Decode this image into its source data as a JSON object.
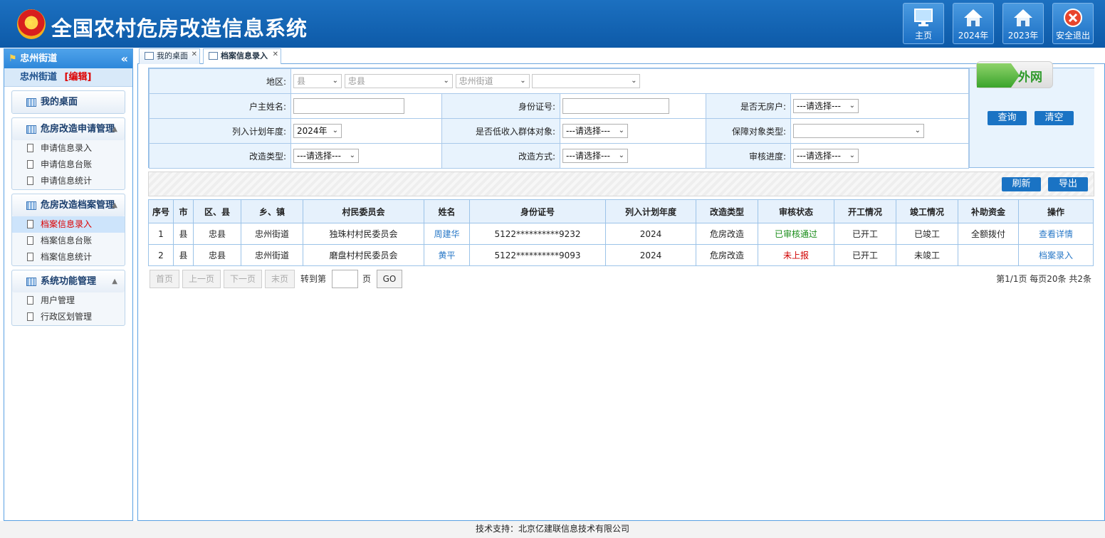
{
  "header": {
    "title": "全国农村危房改造信息系统",
    "buttons": [
      {
        "label": "主页",
        "icon": "monitor-icon"
      },
      {
        "label": "2024年",
        "icon": "house-icon"
      },
      {
        "label": "2023年",
        "icon": "house-icon"
      },
      {
        "label": "安全退出",
        "icon": "close-icon"
      }
    ]
  },
  "sidebar": {
    "region": "忠州街道",
    "user": "忠州街道",
    "edit_label": "[编辑]",
    "collapse_glyph": "«",
    "groups": [
      {
        "title": "我的桌面",
        "items": []
      },
      {
        "title": "危房改造申请管理",
        "items": [
          "申请信息录入",
          "申请信息台账",
          "申请信息统计"
        ]
      },
      {
        "title": "危房改造档案管理",
        "items": [
          "档案信息录入",
          "档案信息台账",
          "档案信息统计"
        ]
      },
      {
        "title": "系统功能管理",
        "items": [
          "用户管理",
          "行政区划管理"
        ]
      }
    ]
  },
  "tabs": [
    {
      "label": "我的桌面"
    },
    {
      "label": "档案信息录入"
    }
  ],
  "search": {
    "region_label": "地区:",
    "region_selects": [
      "县",
      "忠县",
      "忠州街道",
      ""
    ],
    "owner_label": "户主姓名:",
    "owner_value": "",
    "id_label": "身份证号:",
    "id_value": "",
    "nohouse_label": "是否无房户:",
    "nohouse_value": "---请选择---",
    "year_label": "列入计划年度:",
    "year_value": "2024年",
    "lowincome_label": "是否低收入群体对象:",
    "lowincome_value": "---请选择---",
    "guarantee_label": "保障对象类型:",
    "guarantee_value": "",
    "type_label": "改造类型:",
    "type_value": "---请选择---",
    "method_label": "改造方式:",
    "method_value": "---请选择---",
    "audit_label": "审核进度:",
    "audit_value": "---请选择---",
    "network_badge": "外网",
    "query_button": "查询",
    "clear_button": "清空"
  },
  "actions": {
    "refresh": "刷新",
    "export": "导出"
  },
  "table": {
    "headers": [
      "序号",
      "市",
      "区、县",
      "乡、镇",
      "村民委员会",
      "姓名",
      "身份证号",
      "列入计划年度",
      "改造类型",
      "审核状态",
      "开工情况",
      "竣工情况",
      "补助资金",
      "操作"
    ],
    "rows": [
      [
        "1",
        "县",
        "忠县",
        "忠州街道",
        "独珠村村民委员会",
        "周建华",
        "5122**********9232",
        "2024",
        "危房改造",
        "已审核通过",
        "已开工",
        "已竣工",
        "全额拨付",
        "查看详情"
      ],
      [
        "2",
        "县",
        "忠县",
        "忠州街道",
        "磨盘村村民委员会",
        "黄平",
        "5122**********9093",
        "2024",
        "危房改造",
        "未上报",
        "已开工",
        "未竣工",
        "",
        "档案录入"
      ]
    ]
  },
  "pager": {
    "first": "首页",
    "prev": "上一页",
    "next": "下一页",
    "last": "末页",
    "goto_label": "转到第",
    "page_unit": "页",
    "go": "GO",
    "summary": "第1/1页  每页20条 共2条"
  },
  "footer": "技术支持：北京亿建联信息技术有限公司",
  "colors": {
    "header": "#1565b8",
    "accent": "#1a73c4",
    "ok": "#198c19",
    "warn": "#d00000"
  }
}
